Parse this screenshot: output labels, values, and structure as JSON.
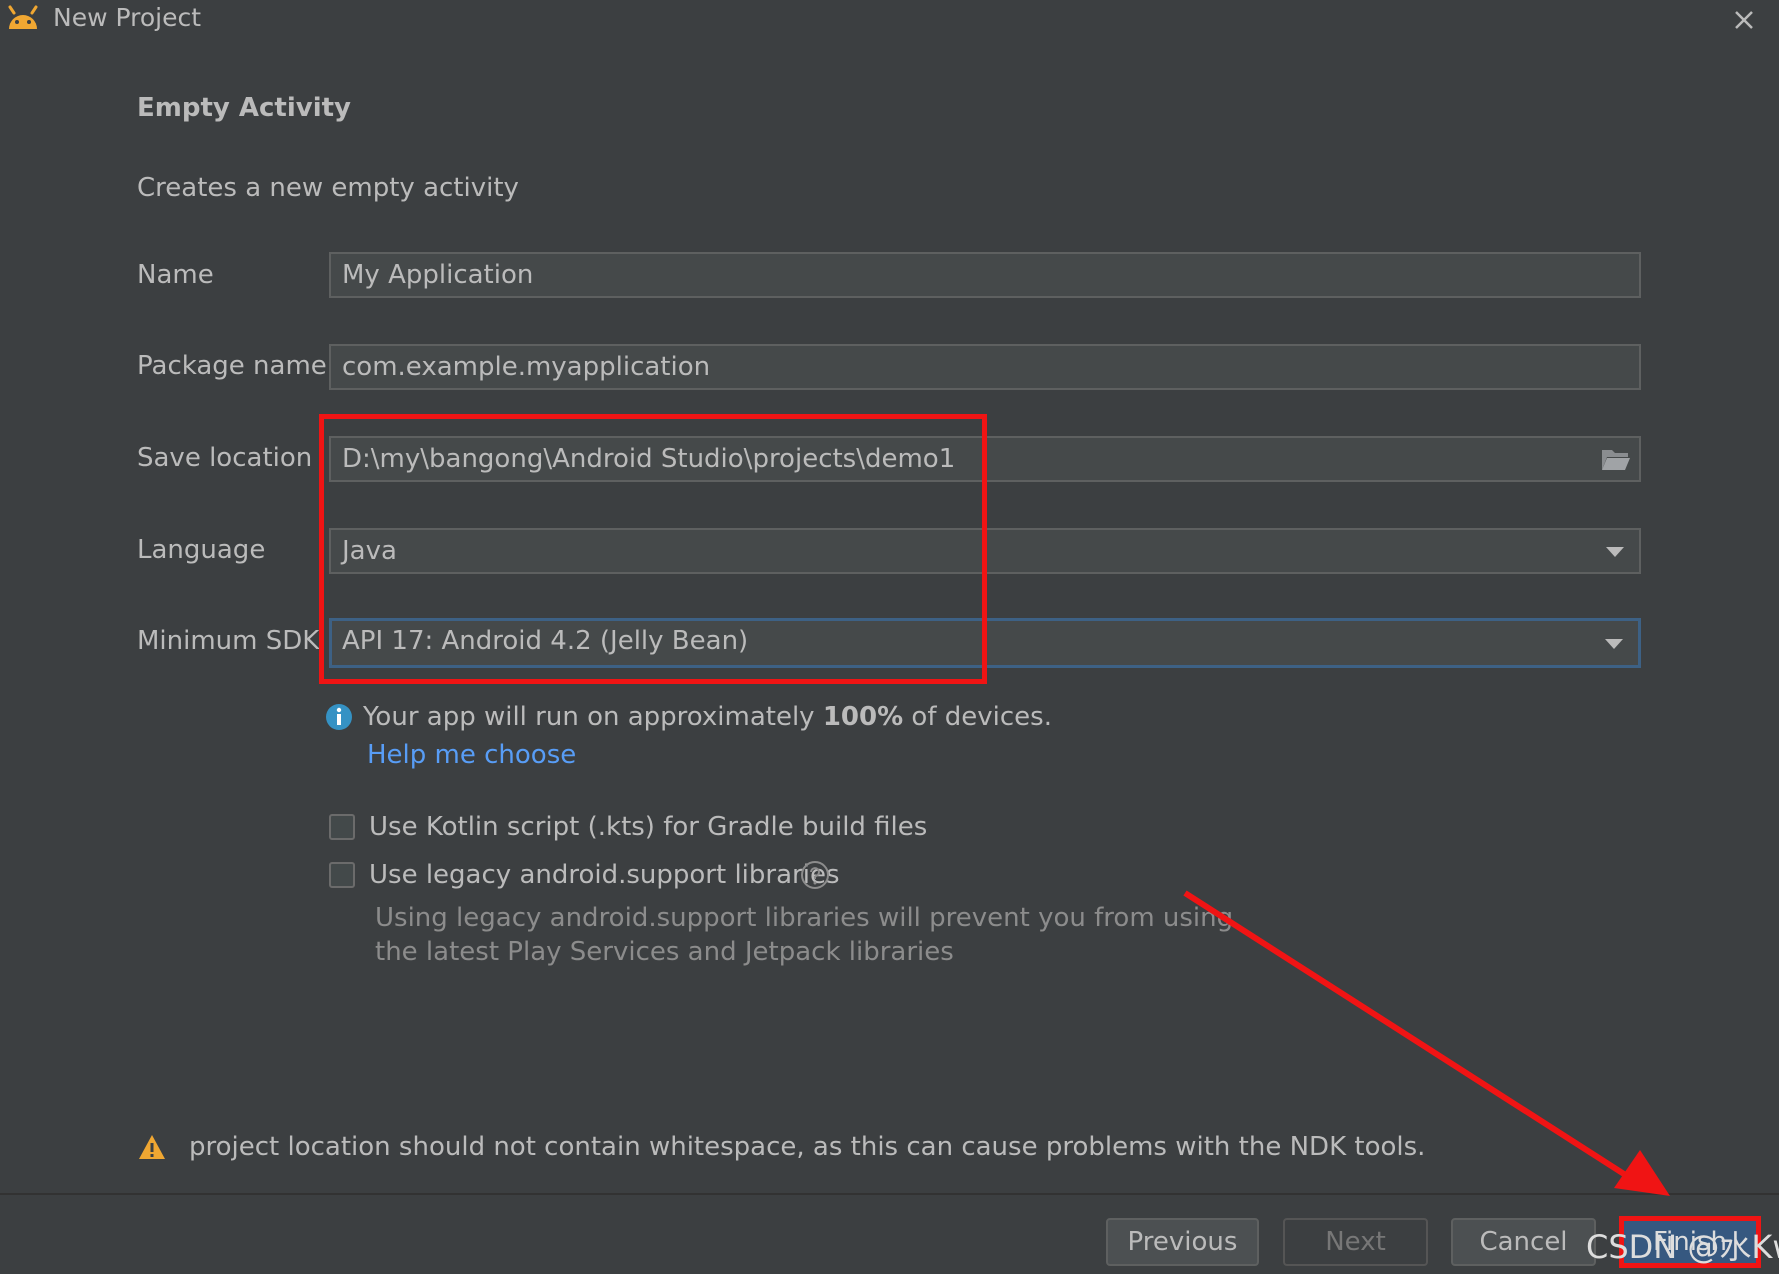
{
  "window": {
    "title": "New Project"
  },
  "template": {
    "heading": "Empty Activity",
    "description": "Creates a new empty activity"
  },
  "form": {
    "name_label": "Name",
    "name_value": "My Application",
    "package_label": "Package name",
    "package_value": "com.example.myapplication",
    "location_label": "Save location",
    "location_value": "D:\\my\\bangong\\Android Studio\\projects\\demo1",
    "language_label": "Language",
    "language_value": "Java",
    "sdk_label": "Minimum SDK",
    "sdk_value": "API 17: Android 4.2 (Jelly Bean)"
  },
  "info": {
    "text_before": "Your app will run on approximately ",
    "percent": "100%",
    "text_after": " of devices.",
    "help_link": "Help me choose"
  },
  "options": {
    "kotlin_dsl_label": "Use Kotlin script (.kts) for Gradle build files",
    "kotlin_dsl_checked": false,
    "legacy_label": "Use legacy android.support libraries",
    "legacy_checked": false,
    "legacy_hint_line1": "Using legacy android.support libraries will prevent you from using",
    "legacy_hint_line2": "the latest Play Services and Jetpack libraries"
  },
  "warning": {
    "text": "project location should not contain whitespace, as this can cause problems with the NDK tools."
  },
  "buttons": {
    "previous": "Previous",
    "next": "Next",
    "cancel": "Cancel",
    "finish": "Finish"
  },
  "watermark": "CSDN @水Kw",
  "colors": {
    "background": "#3c3f41",
    "field_bg": "#45494a",
    "link": "#589df6",
    "annotation_red": "#f01414",
    "warning": "#f0a732",
    "info": "#3592c4"
  }
}
